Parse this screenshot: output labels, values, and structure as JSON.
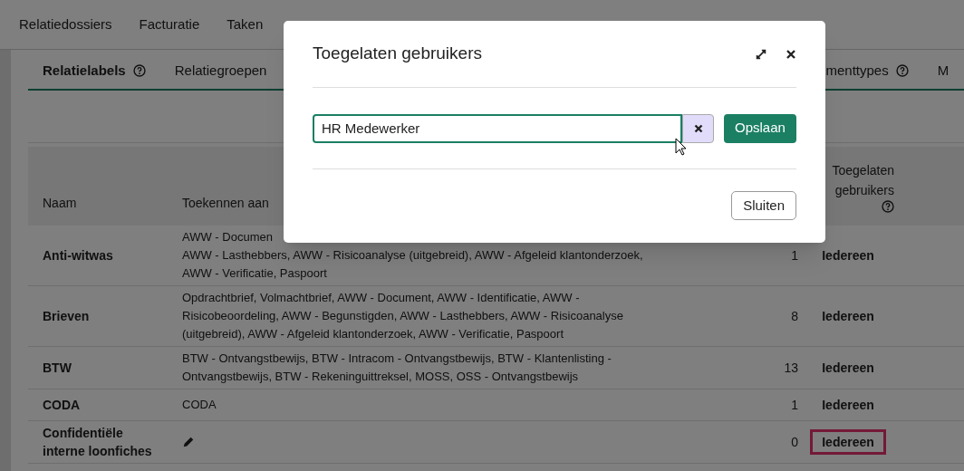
{
  "nav": {
    "items": [
      "Relatiedossiers",
      "Facturatie",
      "Taken"
    ]
  },
  "tabs": [
    {
      "label": "Relatielabels",
      "help": true,
      "selected": true
    },
    {
      "label": "Relatiegroepen",
      "help": false,
      "selected": false
    },
    {
      "label": "menttypes",
      "help": true,
      "selected": false
    },
    {
      "label": "M",
      "help": false,
      "selected": false
    }
  ],
  "table": {
    "columns": [
      "Naam",
      "Toekennen aan",
      "Toegelaten gebruikers"
    ],
    "rows": [
      {
        "name": "Anti-witwas",
        "assigned": [
          "AWW - Documen",
          "AWW - Lasthebbers, AWW - Risicoanalyse (uitgebreid), AWW - Afgeleid klantonderzoek,",
          "AWW - Verificatie, Paspoort"
        ],
        "count": "1",
        "users": "Iedereen",
        "highlighted": false,
        "editable": false
      },
      {
        "name": "Brieven",
        "assigned": [
          "Opdrachtbrief, Volmachtbrief, AWW - Document, AWW - Identificatie, AWW -",
          "Risicobeoordeling, AWW - Begunstigden, AWW - Lasthebbers, AWW - Risicoanalyse",
          "(uitgebreid), AWW - Afgeleid klantonderzoek, AWW - Verificatie, Paspoort"
        ],
        "count": "8",
        "users": "Iedereen",
        "highlighted": false,
        "editable": false
      },
      {
        "name": "BTW",
        "assigned": [
          "BTW - Ontvangstbewijs, BTW - Intracom - Ontvangstbewijs, BTW - Klantenlisting -",
          "Ontvangstbewijs, BTW - Rekeninguittreksel, MOSS, OSS - Ontvangstbewijs"
        ],
        "count": "13",
        "users": "Iedereen",
        "highlighted": false,
        "editable": false
      },
      {
        "name": "CODA",
        "assigned": [
          "CODA"
        ],
        "count": "1",
        "users": "Iedereen",
        "highlighted": false,
        "editable": false
      },
      {
        "name": "Confidentiële interne loonfiches",
        "count": "0",
        "users": "Iedereen",
        "highlighted": true,
        "editable": true
      }
    ]
  },
  "dialog": {
    "title": "Toegelaten gebruikers",
    "field_value": "HR Medewerker",
    "save": "Opslaan",
    "close": "Sluiten"
  }
}
